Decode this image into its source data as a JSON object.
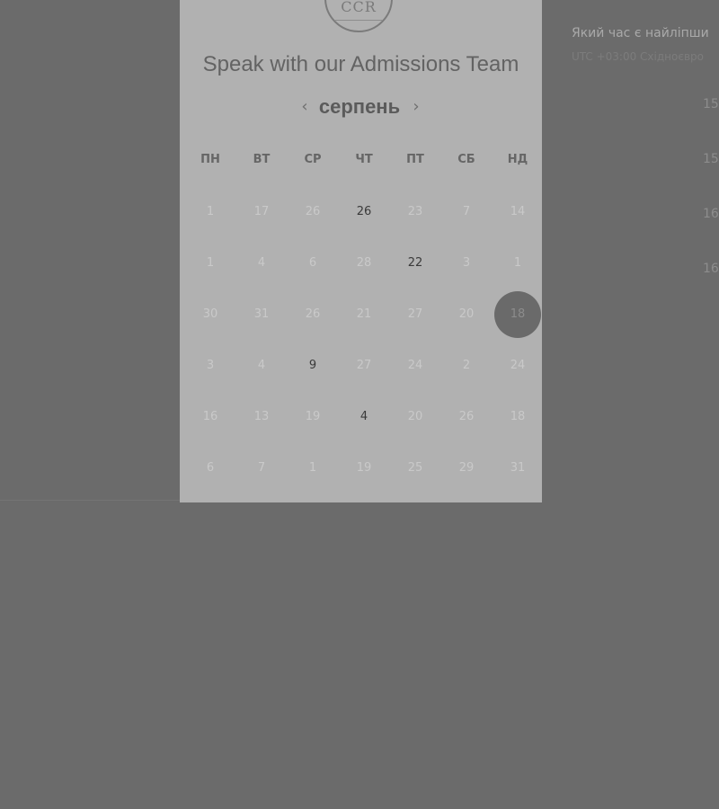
{
  "logo": {
    "text": "CCR"
  },
  "header": {
    "title": "Speak with our Admissions Team"
  },
  "calendar": {
    "month": "серпень",
    "prev_icon": "chevron-left-icon",
    "next_icon": "chevron-right-icon",
    "weekdays": [
      "ПН",
      "ВТ",
      "СР",
      "ЧТ",
      "ПТ",
      "СБ",
      "НД"
    ],
    "weeks": [
      [
        "1",
        "17",
        "26",
        "26",
        "23",
        "7",
        "14"
      ],
      [
        "1",
        "4",
        "6",
        "28",
        "22",
        "3",
        "1"
      ],
      [
        "30",
        "31",
        "26",
        "21",
        "27",
        "20",
        "18"
      ],
      [
        "3",
        "4",
        "9",
        "27",
        "24",
        "2",
        "24"
      ],
      [
        "16",
        "13",
        "19",
        "4",
        "20",
        "26",
        "18"
      ],
      [
        "6",
        "7",
        "1",
        "19",
        "25",
        "29",
        "31"
      ]
    ],
    "available": [
      [
        0,
        3
      ],
      [
        1,
        4
      ],
      [
        3,
        2
      ],
      [
        4,
        3
      ]
    ],
    "selected": [
      2,
      6
    ],
    "colors": {
      "selected_bg": "#6a6a6a",
      "available_text": "#3a3a3a",
      "unavailable_text": "#c9c9c9"
    }
  },
  "side_panel": {
    "question": "Який час є найліпши",
    "timezone": "UTC +03:00 Східноєвро",
    "slots": [
      "15",
      "15",
      "16",
      "16"
    ]
  }
}
